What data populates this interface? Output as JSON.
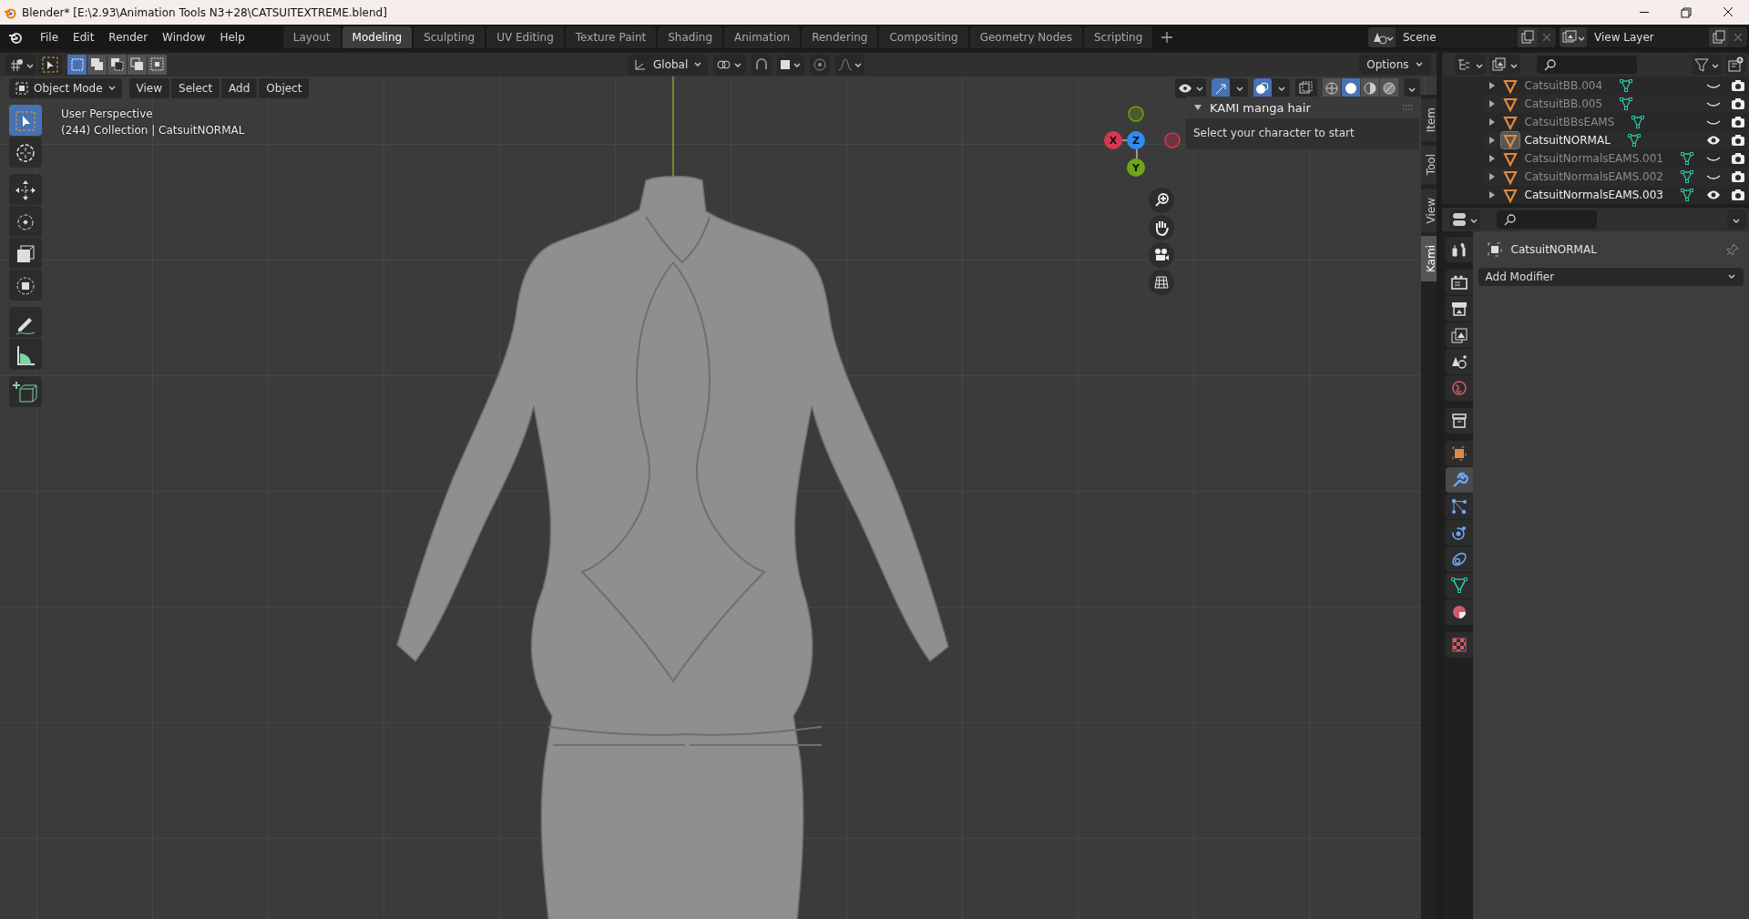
{
  "window": {
    "title": "Blender* [E:\\2.93\\Animation Tools N3+28\\CATSUITEXTREME.blend]"
  },
  "menu": [
    "File",
    "Edit",
    "Render",
    "Window",
    "Help"
  ],
  "workspaces": [
    {
      "label": "Layout",
      "selected": false
    },
    {
      "label": "Modeling",
      "selected": true
    },
    {
      "label": "Sculpting",
      "selected": false
    },
    {
      "label": "UV Editing",
      "selected": false
    },
    {
      "label": "Texture Paint",
      "selected": false
    },
    {
      "label": "Shading",
      "selected": false
    },
    {
      "label": "Animation",
      "selected": false
    },
    {
      "label": "Rendering",
      "selected": false
    },
    {
      "label": "Compositing",
      "selected": false
    },
    {
      "label": "Geometry Nodes",
      "selected": false
    },
    {
      "label": "Scripting",
      "selected": false
    }
  ],
  "scene": {
    "name": "Scene"
  },
  "view_layer": {
    "name": "View Layer"
  },
  "tool_header": {
    "orientation": "Global",
    "options": "Options",
    "select_modes": [
      {
        "kind": "set",
        "selected": true
      },
      {
        "kind": "extend",
        "selected": false
      },
      {
        "kind": "subtract",
        "selected": false
      },
      {
        "kind": "invert",
        "selected": false
      },
      {
        "kind": "intersect",
        "selected": false
      }
    ]
  },
  "viewport_header": {
    "mode": "Object Mode",
    "menus": [
      "View",
      "Select",
      "Add",
      "Object"
    ],
    "shading": [
      {
        "kind": "wireframe",
        "selected": false
      },
      {
        "kind": "solid",
        "selected": true
      },
      {
        "kind": "material",
        "selected": false
      },
      {
        "kind": "rendered",
        "selected": false
      }
    ]
  },
  "toolbar": [
    {
      "kind": "select",
      "selected": true
    },
    {
      "kind": "cursor",
      "selected": false
    },
    {
      "kind": "move",
      "selected": false
    },
    {
      "kind": "rotate",
      "selected": false
    },
    {
      "kind": "scale",
      "selected": false
    },
    {
      "kind": "transform",
      "selected": false
    },
    {
      "kind": "annotate",
      "selected": false
    },
    {
      "kind": "measure",
      "selected": false
    },
    {
      "kind": "add_cube",
      "selected": false
    }
  ],
  "overlay_text": [
    "User Perspective",
    "(244) Collection | CatsuitNORMAL"
  ],
  "gizmo": [
    {
      "label": "X",
      "color": "#d6394f"
    },
    {
      "label": "Z",
      "color": "#2f8cf0"
    },
    {
      "label": "Y",
      "color": "#6ea514"
    }
  ],
  "sidebar": {
    "panel": {
      "title": "KAMI manga hair",
      "expanded": true,
      "text": "Select your character to start"
    },
    "tabs": [
      {
        "label": "Item",
        "selected": false
      },
      {
        "label": "Tool",
        "selected": false
      },
      {
        "label": "View",
        "selected": false
      },
      {
        "label": "Kami",
        "selected": true
      }
    ]
  },
  "outliner": {
    "items": [
      {
        "name": "CatsuitBB.004",
        "active": false,
        "visible": false
      },
      {
        "name": "CatsuitBB.005",
        "active": false,
        "visible": false
      },
      {
        "name": "CatsuitBBsEAMS",
        "active": false,
        "visible": false
      },
      {
        "name": "CatsuitNORMAL",
        "active": true,
        "visible": true
      },
      {
        "name": "CatsuitNormalsEAMS.001",
        "active": false,
        "visible": false
      },
      {
        "name": "CatsuitNormalsEAMS.002",
        "active": false,
        "visible": false
      },
      {
        "name": "CatsuitNormalsEAMS.003",
        "active": false,
        "visible": true
      }
    ]
  },
  "properties": {
    "tabs": [
      {
        "kind": "tool",
        "selected": false
      },
      {
        "kind": "render",
        "selected": false
      },
      {
        "kind": "output",
        "selected": false
      },
      {
        "kind": "view_layer",
        "selected": false
      },
      {
        "kind": "scene",
        "selected": false
      },
      {
        "kind": "world",
        "selected": false
      },
      {
        "kind": "collection",
        "selected": false
      },
      {
        "kind": "object",
        "selected": false
      },
      {
        "kind": "modifiers",
        "selected": true
      },
      {
        "kind": "particles",
        "selected": false
      },
      {
        "kind": "physics",
        "selected": false
      },
      {
        "kind": "constraints",
        "selected": false
      },
      {
        "kind": "data",
        "selected": false
      },
      {
        "kind": "material",
        "selected": false
      },
      {
        "kind": "texture",
        "selected": false
      }
    ],
    "object": "CatsuitNORMAL",
    "add_modifier": "Add Modifier"
  }
}
